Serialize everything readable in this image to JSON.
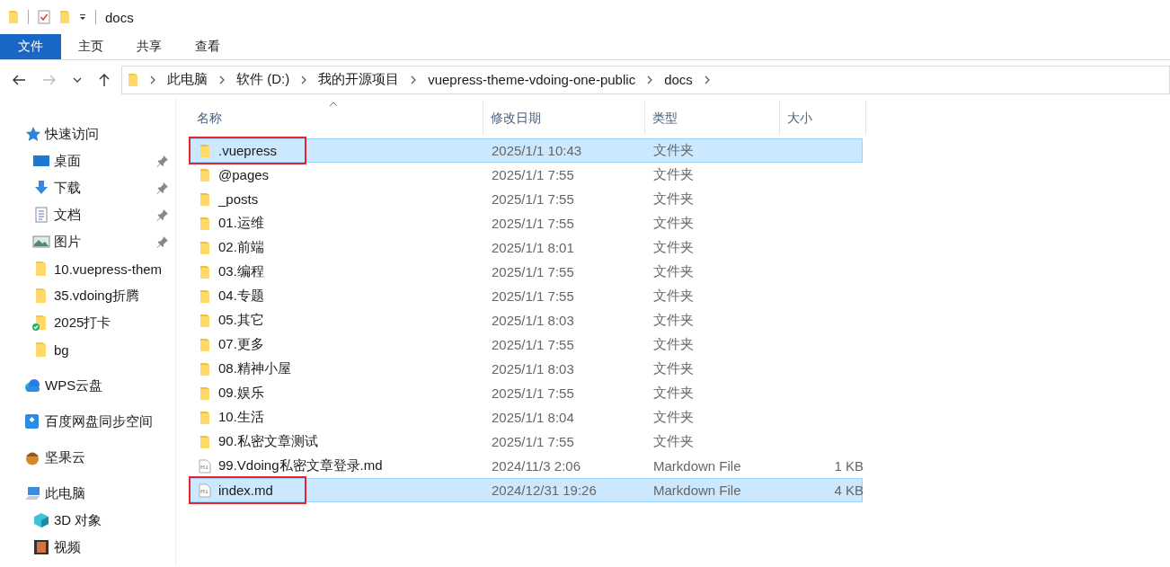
{
  "window": {
    "title": "docs"
  },
  "ribbon_tabs": [
    {
      "label": "文件",
      "selected": true
    },
    {
      "label": "主页",
      "selected": false
    },
    {
      "label": "共享",
      "selected": false
    },
    {
      "label": "查看",
      "selected": false
    }
  ],
  "address_bar": {
    "path": [
      "此电脑",
      "软件 (D:)",
      "我的开源项目",
      "vuepress-theme-vdoing-one-public",
      "docs"
    ]
  },
  "sidebar": {
    "sections": [
      {
        "label": "快速访问",
        "children": [
          {
            "label": "桌面",
            "pinned": true
          },
          {
            "label": "下载",
            "pinned": true
          },
          {
            "label": "文档",
            "pinned": true
          },
          {
            "label": "图片",
            "pinned": true
          },
          {
            "label": "10.vuepress-them",
            "pinned": false
          },
          {
            "label": "35.vdoing折腾",
            "pinned": false
          },
          {
            "label": "2025打卡",
            "pinned": false,
            "synced": true
          },
          {
            "label": "bg",
            "pinned": false
          }
        ]
      },
      {
        "label": "WPS云盘"
      },
      {
        "label": "百度网盘同步空间"
      },
      {
        "label": "坚果云"
      },
      {
        "label": "此电脑",
        "children": [
          {
            "label": "3D 对象",
            "pinned": false
          },
          {
            "label": "视频",
            "pinned": false
          }
        ]
      }
    ]
  },
  "table": {
    "columns": [
      "名称",
      "修改日期",
      "类型",
      "大小"
    ],
    "rows": [
      {
        "name": ".vuepress",
        "date": "2025/1/1 10:43",
        "type": "文件夹",
        "kind": "folder",
        "selected": true,
        "annotated": true
      },
      {
        "name": "@pages",
        "date": "2025/1/1 7:55",
        "type": "文件夹",
        "kind": "folder",
        "selected": false,
        "annotated": false
      },
      {
        "name": "_posts",
        "date": "2025/1/1 7:55",
        "type": "文件夹",
        "kind": "folder",
        "selected": false,
        "annotated": false
      },
      {
        "name": "01.运维",
        "date": "2025/1/1 7:55",
        "type": "文件夹",
        "kind": "folder",
        "selected": false,
        "annotated": false
      },
      {
        "name": "02.前端",
        "date": "2025/1/1 8:01",
        "type": "文件夹",
        "kind": "folder",
        "selected": false,
        "annotated": false
      },
      {
        "name": "03.编程",
        "date": "2025/1/1 7:55",
        "type": "文件夹",
        "kind": "folder",
        "selected": false,
        "annotated": false
      },
      {
        "name": "04.专题",
        "date": "2025/1/1 7:55",
        "type": "文件夹",
        "kind": "folder",
        "selected": false,
        "annotated": false
      },
      {
        "name": "05.其它",
        "date": "2025/1/1 8:03",
        "type": "文件夹",
        "kind": "folder",
        "selected": false,
        "annotated": false
      },
      {
        "name": "07.更多",
        "date": "2025/1/1 7:55",
        "type": "文件夹",
        "kind": "folder",
        "selected": false,
        "annotated": false
      },
      {
        "name": "08.精神小屋",
        "date": "2025/1/1 8:03",
        "type": "文件夹",
        "kind": "folder",
        "selected": false,
        "annotated": false
      },
      {
        "name": "09.娱乐",
        "date": "2025/1/1 7:55",
        "type": "文件夹",
        "kind": "folder",
        "selected": false,
        "annotated": false
      },
      {
        "name": "10.生活",
        "date": "2025/1/1 8:04",
        "type": "文件夹",
        "kind": "folder",
        "selected": false,
        "annotated": false
      },
      {
        "name": "90.私密文章测试",
        "date": "2025/1/1 7:55",
        "type": "文件夹",
        "kind": "folder",
        "selected": false,
        "annotated": false
      },
      {
        "name": "99.Vdoing私密文章登录.md",
        "date": "2024/11/3 2:06",
        "type": "Markdown File",
        "size": "1 KB",
        "kind": "markdown",
        "selected": false,
        "annotated": false
      },
      {
        "name": "index.md",
        "date": "2024/12/31 19:26",
        "type": "Markdown File",
        "size": "4 KB",
        "kind": "markdown",
        "selected": true,
        "annotated": true
      }
    ]
  }
}
